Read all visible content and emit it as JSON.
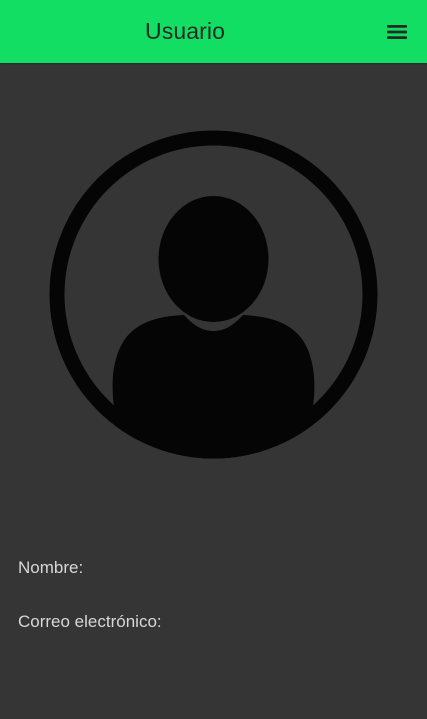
{
  "header": {
    "title": "Usuario",
    "menu_icon": "hamburger-menu-icon",
    "background_color": "#12de64"
  },
  "profile": {
    "avatar_icon": "user-avatar-icon",
    "name_label": "Nombre:",
    "email_label": "Correo electrónico:"
  },
  "theme": {
    "background_color": "#353535",
    "text_color": "#d7d7d7"
  }
}
